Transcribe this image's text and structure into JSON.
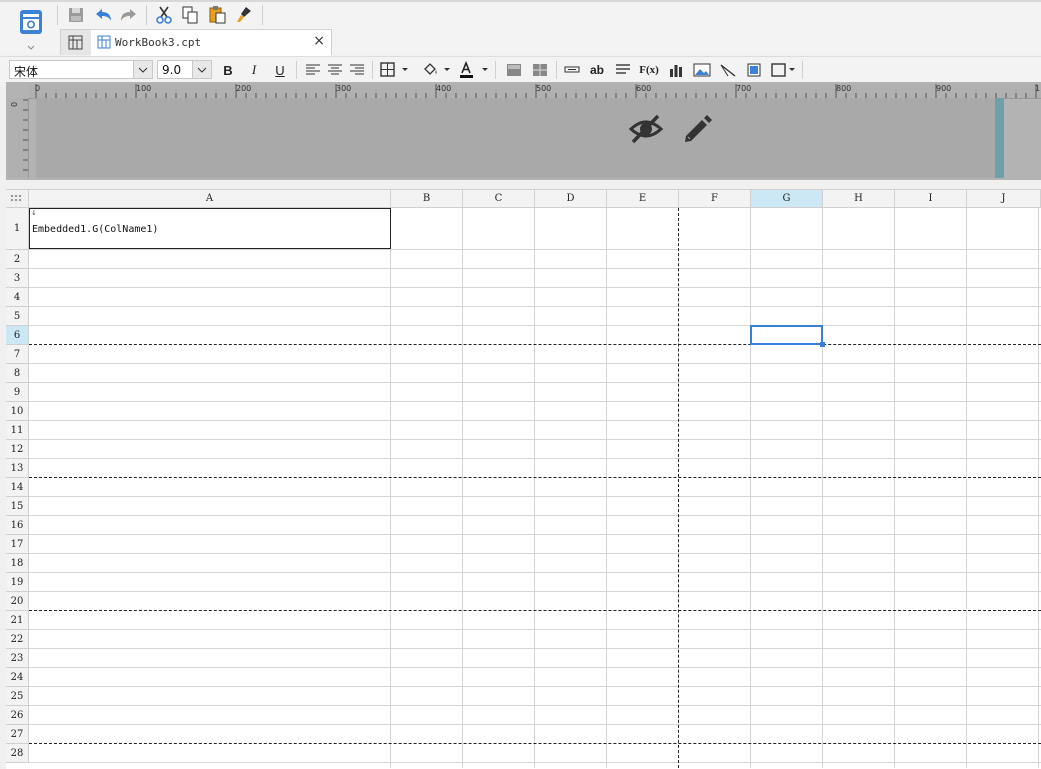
{
  "toolbar": {
    "app_button": "designer-menu-icon",
    "quick_actions": [
      {
        "name": "save-icon"
      },
      {
        "name": "undo-icon"
      },
      {
        "name": "redo-icon"
      },
      {
        "name": "cut-icon"
      },
      {
        "name": "copy-icon"
      },
      {
        "name": "paste-icon"
      },
      {
        "name": "format-painter-icon"
      }
    ]
  },
  "document_tab": {
    "title": "WorkBook3.cpt",
    "close_symbol": "×"
  },
  "format_bar": {
    "font_name": "宋体",
    "font_size": "9.0",
    "bold": "B",
    "italic": "I",
    "underline": "U",
    "text_label": "ab",
    "formula_label": "F(x)"
  },
  "ruler": {
    "h_labels": [
      "0",
      "100",
      "200",
      "300",
      "400",
      "500",
      "600",
      "700",
      "800",
      "900",
      "1"
    ],
    "v_label": "0"
  },
  "band_icons": [
    "hidden-eye-icon",
    "edit-pencil-icon"
  ],
  "grid": {
    "columns": [
      "A",
      "B",
      "C",
      "D",
      "E",
      "F",
      "G",
      "H",
      "I",
      "J"
    ],
    "selected_column": "G",
    "rows": [
      "1",
      "2",
      "3",
      "4",
      "5",
      "6",
      "7",
      "8",
      "9",
      "10",
      "11",
      "12",
      "13",
      "14",
      "15",
      "16",
      "17",
      "18",
      "19",
      "20",
      "21",
      "22",
      "23",
      "24",
      "25",
      "26",
      "27",
      "28"
    ],
    "selected_row": "6",
    "cell_A1": "Embedded1.G(ColName1)",
    "cell_A1_marker": "↓"
  },
  "colors": {
    "accent": "#3d7fd6",
    "header_selected": "#cde8f5",
    "band_margin": "#6fa0aa"
  }
}
